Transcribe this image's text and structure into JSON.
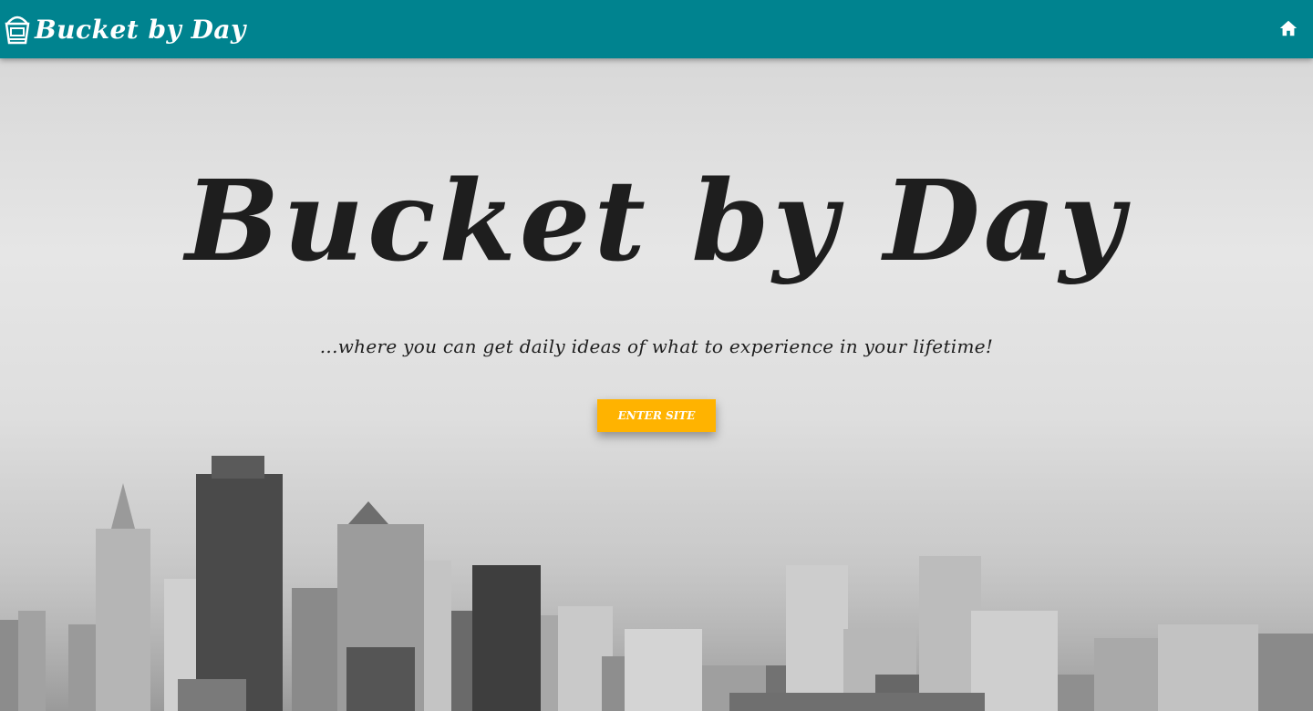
{
  "navbar": {
    "brand_text": "Bucket by Day",
    "brand_icon": "bucket-icon",
    "home_icon": "home-icon",
    "color": "#00838f"
  },
  "hero": {
    "title": "Bucket by Day",
    "tagline": "...where you can get daily ideas of what to experience in your lifetime!",
    "cta_label": "Enter Site",
    "cta_color": "#ffb300",
    "background_image": "city-skyline-grayscale"
  }
}
